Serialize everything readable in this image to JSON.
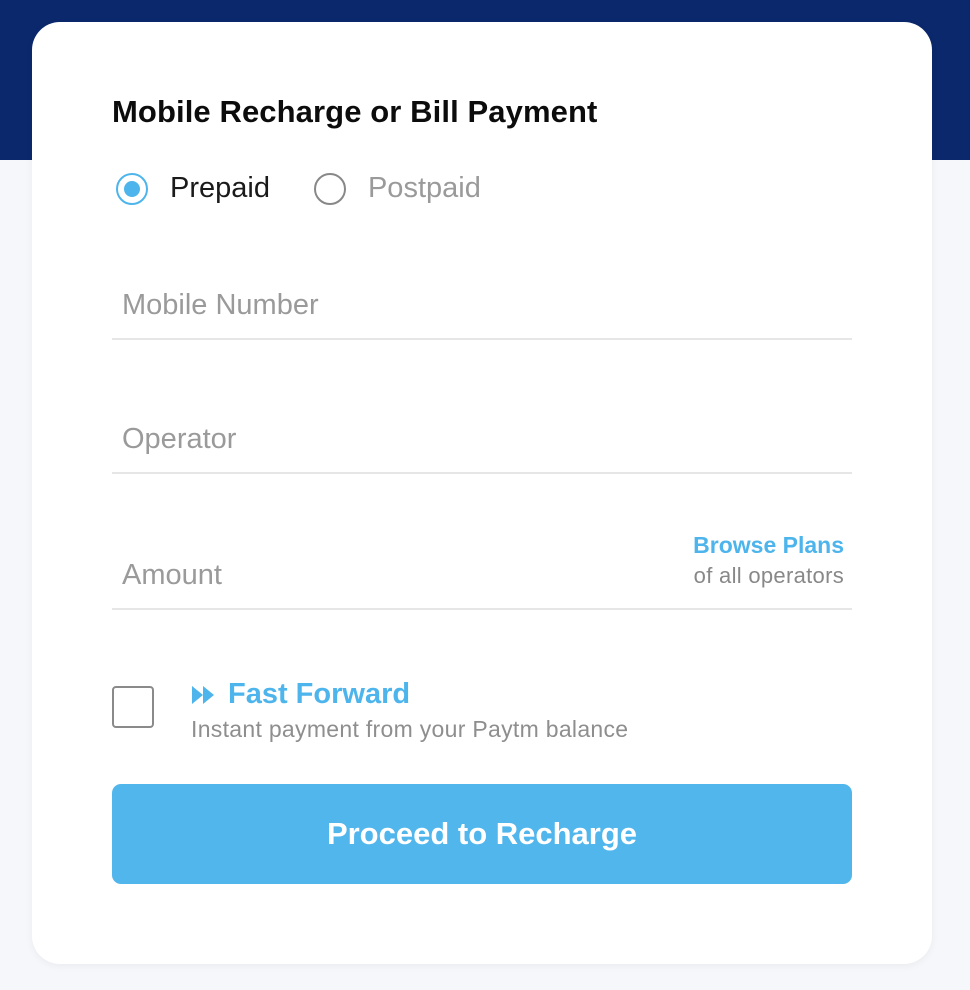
{
  "form": {
    "title": "Mobile Recharge or Bill Payment",
    "plan_type": {
      "options": [
        {
          "label": "Prepaid",
          "selected": true
        },
        {
          "label": "Postpaid",
          "selected": false
        }
      ]
    },
    "mobile_number": {
      "placeholder": "Mobile Number",
      "value": ""
    },
    "operator": {
      "placeholder": "Operator",
      "value": ""
    },
    "amount": {
      "placeholder": "Amount",
      "value": ""
    },
    "browse_plans": {
      "link": "Browse Plans",
      "subtext": "of all operators"
    },
    "fast_forward": {
      "title": "Fast Forward",
      "subtitle": "Instant payment from your Paytm balance",
      "checked": false,
      "icon": "fast-forward-icon"
    },
    "submit_label": "Proceed to Recharge"
  },
  "colors": {
    "header_band": "#0b286c",
    "accent": "#4db5ec",
    "button": "#50b6ec"
  }
}
